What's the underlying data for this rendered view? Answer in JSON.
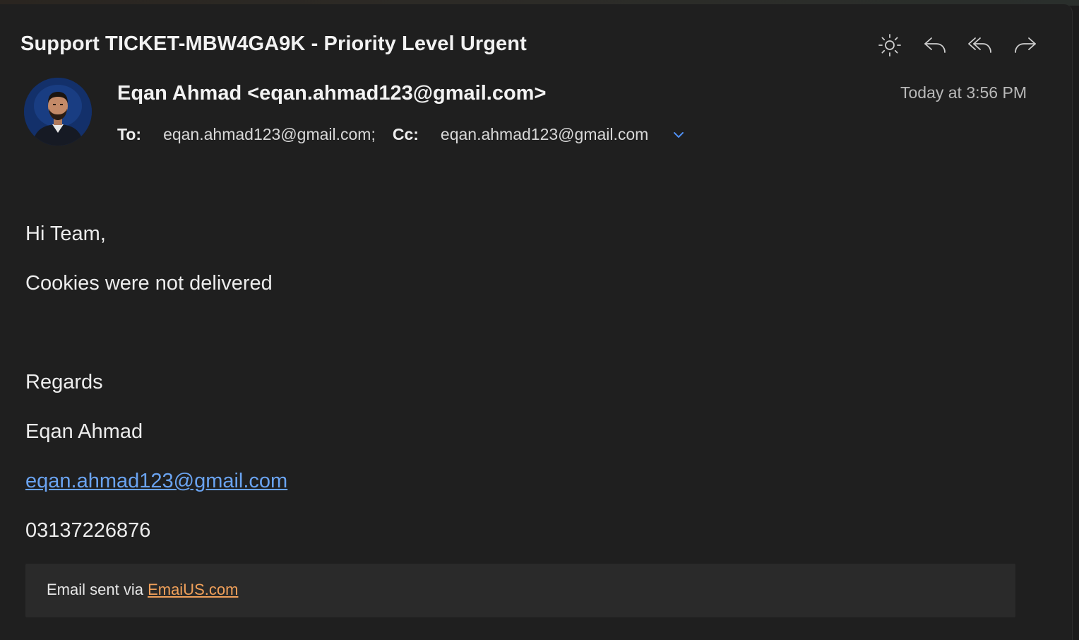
{
  "header": {
    "subject": "Support TICKET-MBW4GA9K - Priority Level Urgent",
    "toolbar": [
      {
        "name": "brightness-icon",
        "label": "Appearance"
      },
      {
        "name": "reply-icon",
        "label": "Reply"
      },
      {
        "name": "reply-all-icon",
        "label": "Reply All"
      },
      {
        "name": "forward-icon",
        "label": "Forward"
      }
    ]
  },
  "message": {
    "sender": "Eqan Ahmad <eqan.ahmad123@gmail.com>",
    "date": "Today at 3:56 PM",
    "to_label": "To:",
    "to_value": "eqan.ahmad123@gmail.com;",
    "cc_label": "Cc:",
    "cc_value": "eqan.ahmad123@gmail.com"
  },
  "body": {
    "greeting": "Hi Team,",
    "content": "Cookies were not delivered",
    "signoff": "Regards",
    "name": "Eqan Ahmad",
    "email": "eqan.ahmad123@gmail.com",
    "phone": "03137226876"
  },
  "footer": {
    "prefix": "Email sent via ",
    "link": "EmaiUS.com"
  },
  "colors": {
    "background": "#1f1f1f",
    "link_blue": "#6aa3f0",
    "footer_link_orange": "#f0a05a",
    "chevron_blue": "#4f8ef0"
  }
}
